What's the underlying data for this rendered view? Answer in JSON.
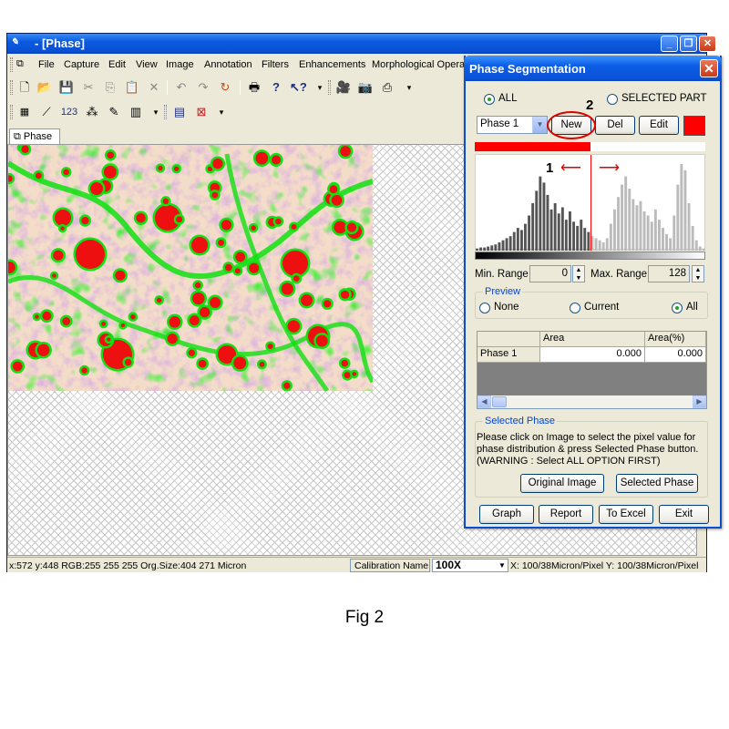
{
  "window": {
    "title": "- [Phase]",
    "minimize": "_",
    "restore": "❐",
    "close": "✕"
  },
  "menu": [
    "File",
    "Capture",
    "Edit",
    "View",
    "Image",
    "Annotation",
    "Filters",
    "Enhancements",
    "Morphological Operat"
  ],
  "toolbar1_icons": [
    "new-icon",
    "open-icon",
    "save-icon",
    "cut-icon",
    "copy-icon",
    "paste-icon",
    "delete-icon",
    "undo-icon",
    "redo-icon",
    "refresh-icon",
    "print-icon",
    "help-icon",
    "context-help-icon",
    "video-icon",
    "camera-icon",
    "capture-icon"
  ],
  "toolbar2_icons": [
    "calibrate-icon",
    "measure-icon",
    "count-icon",
    "phase-icon",
    "pencil-icon",
    "histogram-icon",
    "report-icon",
    "close-doc-icon"
  ],
  "toolbar2_count_text": "123",
  "doc_tab": "Phase",
  "statusbar": {
    "left": "x:572 y:448 RGB:255 255 255 Org.Size:404 271 Micron",
    "calibration_label": "Calibration Name",
    "calibration_value": "100X",
    "right": "X: 100/38Micron/Pixel Y: 100/38Micron/Pixel"
  },
  "dialog": {
    "title": "Phase Segmentation",
    "close": "✕",
    "radio_all": "ALL",
    "radio_selected_part": "SELECTED PART",
    "radio_all_selected": true,
    "phase_select_value": "Phase 1",
    "btn_new": "New",
    "btn_del": "Del",
    "btn_edit": "Edit",
    "phase_color": "#ff0000",
    "range_fill_fraction": 0.5,
    "histogram_heights": [
      2,
      3,
      3,
      4,
      5,
      6,
      8,
      10,
      12,
      14,
      18,
      22,
      20,
      26,
      34,
      46,
      58,
      72,
      66,
      54,
      40,
      46,
      36,
      42,
      30,
      38,
      28,
      24,
      30,
      22,
      18,
      14,
      12,
      10,
      8,
      12,
      26,
      40,
      52,
      64,
      72,
      60,
      50,
      44,
      48,
      38,
      34,
      28,
      40,
      30,
      22,
      16,
      12,
      34,
      64,
      84,
      78,
      46,
      24,
      10,
      4,
      2
    ],
    "annot_1": "1",
    "annot_2": "2",
    "min_range_label": "Min. Range",
    "min_range_value": "0",
    "max_range_label": "Max. Range",
    "max_range_value": "128",
    "preview_title": "Preview",
    "preview_none": "None",
    "preview_current": "Current",
    "preview_all": "All",
    "table": {
      "columns": [
        "",
        "Area",
        "Area(%)"
      ],
      "rows": [
        [
          "Phase 1",
          "0.000",
          "0.000"
        ]
      ]
    },
    "selected_phase_title": "Selected Phase",
    "selected_phase_text": "Please click on Image to select the pixel value for phase distribution & press Selected Phase button. (WARNING : Select ALL OPTION FIRST)",
    "btn_original_image": "Original Image",
    "btn_selected_phase": "Selected Phase",
    "btn_graph": "Graph",
    "btn_report": "Report",
    "btn_to_excel": "To Excel",
    "btn_exit": "Exit"
  },
  "caption": "Fig 2"
}
